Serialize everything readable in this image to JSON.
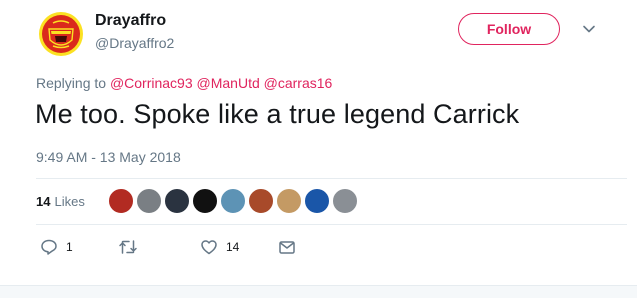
{
  "tweet": {
    "author": {
      "display_name": "Drayaffro",
      "handle": "@Drayaffro2",
      "avatar_icon": "manchester-united-crest"
    },
    "follow_label": "Follow",
    "replying_prefix": "Replying to",
    "replying_to": [
      "@Corrinac93",
      "@ManUtd",
      "@carras16"
    ],
    "text": "Me too. Spoke like a true legend Carrick",
    "timestamp": "9:49 AM - 13 May 2018",
    "likes_count": "14",
    "likes_label": "Likes",
    "actions": {
      "reply_count": "1",
      "retweet_count": "",
      "like_count": "14"
    }
  },
  "colors": {
    "accent": "#e0245e",
    "secondary_text": "#657786",
    "divider": "#e6ecf0"
  }
}
